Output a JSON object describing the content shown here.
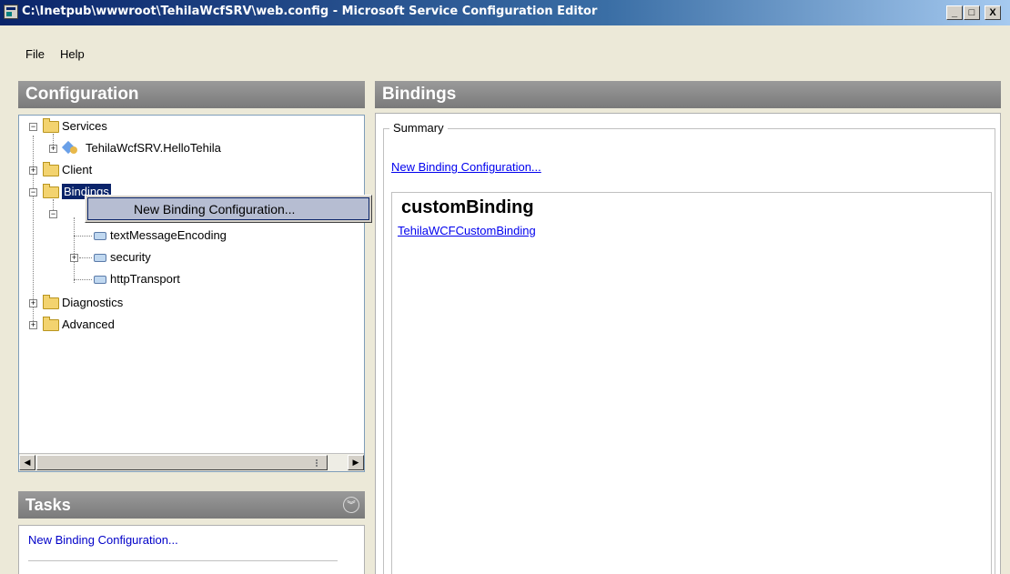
{
  "window": {
    "title": "C:\\Inetpub\\wwwroot\\TehilaWcfSRV\\web.config - Microsoft Service Configuration Editor",
    "minimize_glyph": "_",
    "maximize_glyph": "□",
    "close_glyph": "X"
  },
  "menu": {
    "file": "File",
    "help": "Help"
  },
  "left_panel": {
    "header": "Configuration",
    "tree": {
      "services": "Services",
      "service_item": "TehilaWcfSRV.HelloTehila",
      "client": "Client",
      "bindings": "Bindings",
      "text_message_encoding": "textMessageEncoding",
      "security": "security",
      "http_transport": "httpTransport",
      "diagnostics": "Diagnostics",
      "advanced": "Advanced"
    },
    "context_menu": {
      "item": "New Binding Configuration..."
    }
  },
  "tasks": {
    "header": "Tasks",
    "collapse_glyph": "︾",
    "new_binding": "New Binding Configuration..."
  },
  "right_panel": {
    "header": "Bindings",
    "summary_legend": "Summary",
    "summary_link": "New Binding Configuration...",
    "binding_type": "customBinding",
    "binding_item": "TehilaWCFCustomBinding"
  },
  "colors": {
    "title_start": "#0a246a",
    "panel_header": "#8a8a8a",
    "link": "#0000ee",
    "selection": "#b6bdd2"
  },
  "icons": [
    "app-icon",
    "folder-icon",
    "service-icon",
    "element-icon",
    "collapse-icon"
  ]
}
